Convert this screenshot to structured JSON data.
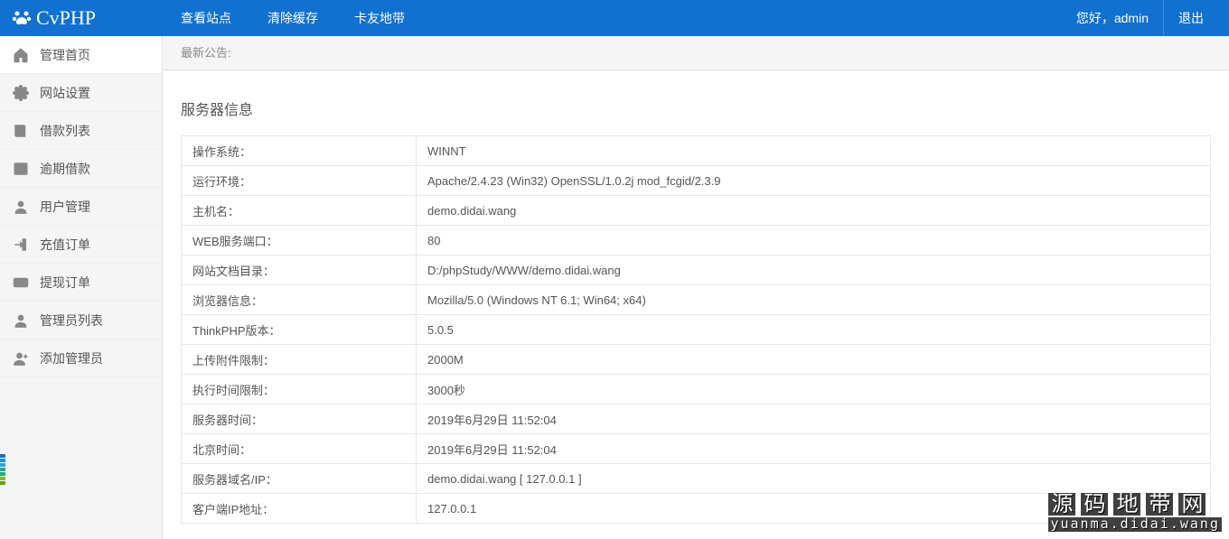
{
  "header": {
    "brand": "CvPHP",
    "menu": [
      "查看站点",
      "清除缓存",
      "卡友地带"
    ],
    "greeting": "您好，admin",
    "logout": "退出"
  },
  "sidebar": {
    "items": [
      {
        "label": "管理首页",
        "icon": "home"
      },
      {
        "label": "网站设置",
        "icon": "gear"
      },
      {
        "label": "借款列表",
        "icon": "book"
      },
      {
        "label": "逾期借款",
        "icon": "table"
      },
      {
        "label": "用户管理",
        "icon": "user"
      },
      {
        "label": "充值订单",
        "icon": "enter"
      },
      {
        "label": "提现订单",
        "icon": "money"
      },
      {
        "label": "管理员列表",
        "icon": "user"
      },
      {
        "label": "添加管理员",
        "icon": "user-plus"
      }
    ]
  },
  "notice": "最新公告:",
  "section_title": "服务器信息",
  "info": [
    {
      "label": "操作系统：",
      "value": "WINNT"
    },
    {
      "label": "运行环境：",
      "value": "Apache/2.4.23 (Win32) OpenSSL/1.0.2j mod_fcgid/2.3.9"
    },
    {
      "label": "主机名：",
      "value": "demo.didai.wang"
    },
    {
      "label": "WEB服务端口：",
      "value": "80"
    },
    {
      "label": "网站文档目录：",
      "value": "D:/phpStudy/WWW/demo.didai.wang"
    },
    {
      "label": "浏览器信息：",
      "value": "Mozilla/5.0 (Windows NT 6.1; Win64; x64)"
    },
    {
      "label": "ThinkPHP版本：",
      "value": "5.0.5"
    },
    {
      "label": "上传附件限制：",
      "value": "2000M"
    },
    {
      "label": "执行时间限制：",
      "value": "3000秒"
    },
    {
      "label": "服务器时间：",
      "value": "2019年6月29日 11:52:04"
    },
    {
      "label": "北京时间：",
      "value": "2019年6月29日 11:52:04"
    },
    {
      "label": "服务器域名/IP：",
      "value": "demo.didai.wang [ 127.0.0.1 ]"
    },
    {
      "label": "客户端IP地址：",
      "value": "127.0.0.1"
    }
  ],
  "watermark": {
    "cn": [
      "源",
      "码",
      "地",
      "带",
      "网"
    ],
    "url": "yuanma.didai.wang"
  }
}
